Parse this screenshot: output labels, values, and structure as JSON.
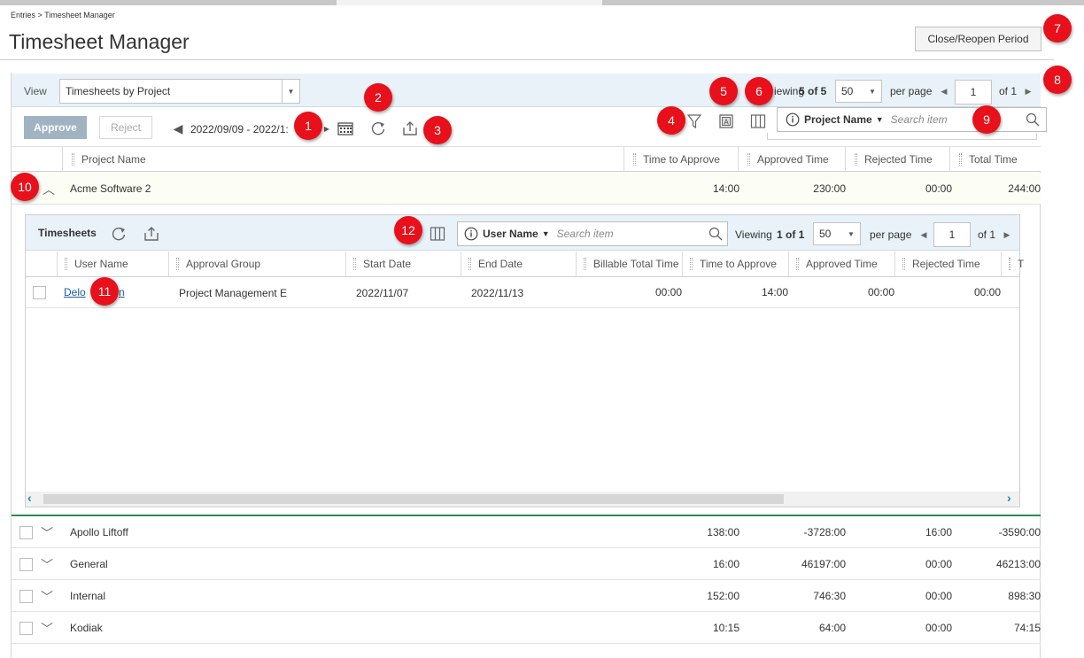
{
  "breadcrumb": "Entries > Timesheet Manager",
  "page_title": "Timesheet Manager",
  "close_reopen_label": "Close/Reopen Period",
  "view": {
    "label": "View",
    "selected": "Timesheets by Project"
  },
  "pager": {
    "viewing_text": "iewing",
    "viewing_count": "5 of 5",
    "per_page_value": "50",
    "per_page_label": "per page",
    "page_value": "1",
    "of_text": "of 1"
  },
  "toolbar": {
    "approve_label": "Approve",
    "reject_label": "Reject",
    "date_range": "2022/09/09 - 2022/1:"
  },
  "search": {
    "field_label": "Project Name",
    "placeholder": "Search item"
  },
  "columns": [
    "Project Name",
    "Time to Approve",
    "Approved Time",
    "Rejected Time",
    "Total Time"
  ],
  "expanded_project": {
    "name": "Acme Software 2",
    "time_to_approve": "14:00",
    "approved_time": "230:00",
    "rejected_time": "00:00",
    "total_time": "244:00"
  },
  "subgrid": {
    "title": "Timesheets",
    "search_field_label": "User Name",
    "search_placeholder": "Search item",
    "viewing_label": "Viewing",
    "viewing_count": "1 of 1",
    "per_page_value": "50",
    "per_page_label": "per page",
    "page_value": "1",
    "of_text": "of 1",
    "columns": [
      "User Name",
      "Approval Group",
      "Start Date",
      "End Date",
      "Billable Total Time",
      "Time to Approve",
      "Approved Time",
      "Rejected Time",
      "T"
    ],
    "row": {
      "user_name": "Delo",
      "user_name_tail": "n",
      "approval_group": "Project Management E",
      "start_date": "2022/11/07",
      "end_date": "2022/11/13",
      "billable_total_time": "00:00",
      "time_to_approve": "14:00",
      "approved_time": "00:00",
      "rejected_time": "00:00"
    }
  },
  "projects": [
    {
      "name": "Apollo Liftoff",
      "time_to_approve": "138:00",
      "approved_time": "-3728:00",
      "rejected_time": "16:00",
      "total_time": "-3590:00"
    },
    {
      "name": "General",
      "time_to_approve": "16:00",
      "approved_time": "46197:00",
      "rejected_time": "00:00",
      "total_time": "46213:00"
    },
    {
      "name": "Internal",
      "time_to_approve": "152:00",
      "approved_time": "746:30",
      "rejected_time": "00:00",
      "total_time": "898:30"
    },
    {
      "name": "Kodiak",
      "time_to_approve": "10:15",
      "approved_time": "64:00",
      "rejected_time": "00:00",
      "total_time": "74:15"
    }
  ],
  "callouts": [
    "1",
    "2",
    "3",
    "4",
    "5",
    "6",
    "7",
    "8",
    "9",
    "10",
    "11",
    "12"
  ],
  "colors": {
    "callout": "#e8101a",
    "approve_bg": "#9fb3c2",
    "band": "#e9f2f9",
    "link": "#1a5fa8",
    "divider_green": "#2e8b57"
  },
  "icons": {
    "calendar": "calendar-icon",
    "refresh": "refresh-icon",
    "export": "export-icon",
    "filter": "filter-icon",
    "text_format": "text-format-icon",
    "columns": "columns-icon",
    "info": "info-icon",
    "search": "search-icon"
  }
}
